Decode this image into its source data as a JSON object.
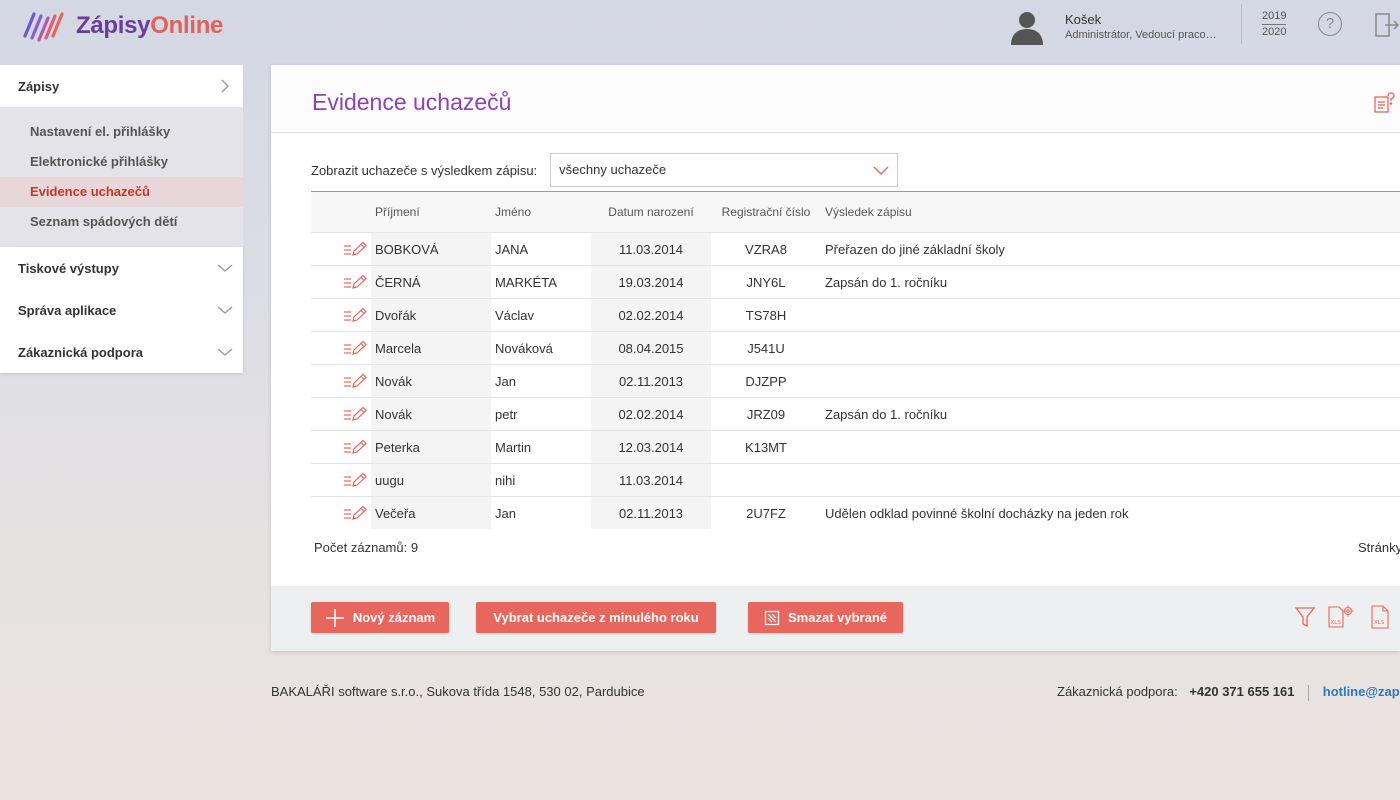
{
  "app": {
    "logo_part1": "Zápisy",
    "logo_part2": "Online"
  },
  "user": {
    "name": "Košek",
    "role": "Administrátor, Vedoucí praco…",
    "year_top": "2019",
    "year_bottom": "2020",
    "help": "?"
  },
  "sidebar": {
    "top_label": "Zápisy",
    "sub_items": [
      {
        "label": "Nastavení el. přihlášky"
      },
      {
        "label": "Elektronické přihlášky"
      },
      {
        "label": "Evidence uchazečů"
      },
      {
        "label": "Seznam spádových dětí"
      }
    ],
    "groups": [
      {
        "label": "Tiskové výstupy"
      },
      {
        "label": "Správa aplikace"
      },
      {
        "label": "Zákaznická podpora"
      }
    ]
  },
  "main": {
    "title": "Evidence uchazečů",
    "filter_label": "Zobrazit uchazeče s výsledkem zápisu:",
    "filter_value": "všechny uchazeče",
    "columns": {
      "surname": "Příjmení",
      "name": "Jméno",
      "dob": "Datum narození",
      "reg": "Registrační číslo",
      "result": "Výsledek zápisu"
    },
    "rows": [
      {
        "surname": "BOBKOVÁ",
        "name": "JANA",
        "dob": "11.03.2014",
        "reg": "VZRA8",
        "result": "Přeřazen do jiné základní školy"
      },
      {
        "surname": "ČERNÁ",
        "name": "MARKÉTA",
        "dob": "19.03.2014",
        "reg": "JNY6L",
        "result": "Zapsán do 1. ročníku"
      },
      {
        "surname": "Dvořák",
        "name": "Václav",
        "dob": "02.02.2014",
        "reg": "TS78H",
        "result": ""
      },
      {
        "surname": "Marcela",
        "name": "Nováková",
        "dob": "08.04.2015",
        "reg": "J541U",
        "result": ""
      },
      {
        "surname": "Novák",
        "name": "Jan",
        "dob": "02.11.2013",
        "reg": "DJZPP",
        "result": ""
      },
      {
        "surname": "Novák",
        "name": "petr",
        "dob": "02.02.2014",
        "reg": "JRZ09",
        "result": "Zapsán do 1. ročníku"
      },
      {
        "surname": "Peterka",
        "name": "Martin",
        "dob": "12.03.2014",
        "reg": "K13MT",
        "result": ""
      },
      {
        "surname": "uugu",
        "name": "nihi",
        "dob": "11.03.2014",
        "reg": "",
        "result": ""
      },
      {
        "surname": "Večeřa",
        "name": "Jan",
        "dob": "02.11.2013",
        "reg": "2U7FZ",
        "result": "Udělen odklad povinné školní docházky na jeden rok"
      }
    ],
    "count_label": "Počet záznamů: 9",
    "pages_label": "Stránky"
  },
  "actions": {
    "new_label": "Nový záznam",
    "prev_year_label": "Vybrat uchazeče z minulého roku",
    "delete_label": "Smazat vybrané"
  },
  "footer": {
    "company": "BAKALÁŘI software s.r.o., Sukova třída 1548, 530 02, Pardubice",
    "support_label": "Zákaznická podpora:",
    "phone": "+420 371 655 161",
    "email": "hotline@zapi"
  },
  "colors": {
    "accent": "#e8675c",
    "title": "#8e44ad",
    "active_nav": "#c0392b",
    "link": "#2a7ab8"
  },
  "icons": [
    "logo-icon",
    "user-avatar-icon",
    "help-icon",
    "logout-icon",
    "chevron-right-icon",
    "chevron-down-icon",
    "edit-icon",
    "page-help-icon",
    "plus-icon",
    "delete-icon",
    "filter-icon",
    "xls-settings-icon",
    "xls-export-icon"
  ]
}
